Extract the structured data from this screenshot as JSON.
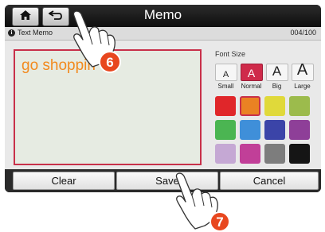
{
  "header": {
    "title": "Memo",
    "home_icon": "home-icon",
    "back_icon": "back-arrow-icon"
  },
  "subbar": {
    "label": "Text Memo",
    "counter": "004/100",
    "info_icon": "info-icon"
  },
  "memo": {
    "text": "go shoppin",
    "text_color": "#f28a1e",
    "border_color": "#c8304a"
  },
  "font_size": {
    "label": "Font Size",
    "options": [
      {
        "glyph": "A",
        "label": "Small",
        "selected": false
      },
      {
        "glyph": "A",
        "label": "Normal",
        "selected": true
      },
      {
        "glyph": "A",
        "label": "Big",
        "selected": false
      },
      {
        "glyph": "A",
        "label": "Large",
        "selected": false
      }
    ]
  },
  "colors": {
    "swatches": [
      "#e0262a",
      "#ea8223",
      "#e0d93a",
      "#9cbb4c",
      "#4bb552",
      "#3f8fd9",
      "#3b44a8",
      "#8e3f98",
      "#c5a8d4",
      "#c13f98",
      "#7d7d7d",
      "#151515"
    ],
    "selected_index": 1,
    "accent": "#cf2a4a"
  },
  "buttons": {
    "clear": "Clear",
    "save": "Save",
    "cancel": "Cancel"
  },
  "callouts": [
    {
      "number": "6",
      "color": "#e8471f"
    },
    {
      "number": "7",
      "color": "#e8471f"
    }
  ]
}
